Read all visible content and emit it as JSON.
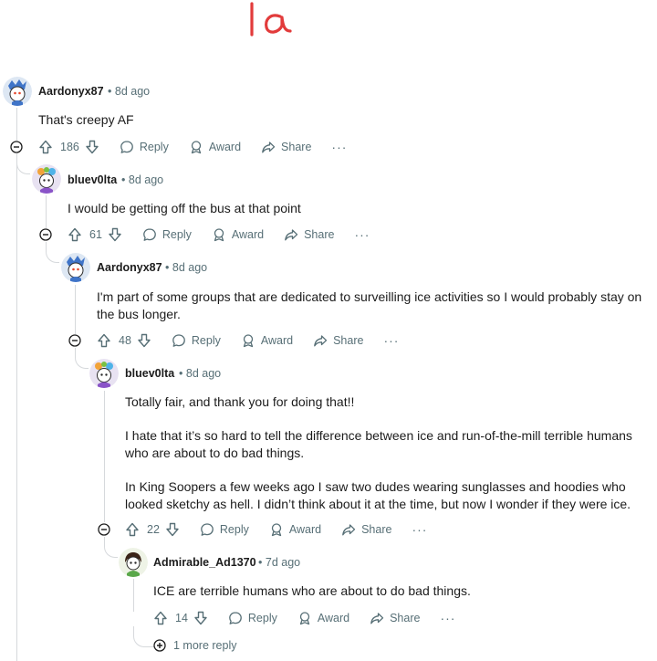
{
  "annotation": {
    "text": "1a",
    "color": "#e23b3b"
  },
  "comments": [
    {
      "username": "Aardonyx87",
      "separator": "•",
      "time": "8d ago",
      "paragraphs": [
        "That's creepy AF"
      ],
      "votes": "186",
      "reply": "Reply",
      "award": "Award",
      "share": "Share",
      "more": "···"
    },
    {
      "username": "bluev0lta",
      "separator": "•",
      "time": "8d ago",
      "paragraphs": [
        "I would be getting off the bus at that point"
      ],
      "votes": "61",
      "reply": "Reply",
      "award": "Award",
      "share": "Share",
      "more": "···"
    },
    {
      "username": "Aardonyx87",
      "separator": "•",
      "time": "8d ago",
      "paragraphs": [
        "I'm part of some groups that are dedicated to surveilling ice activities so I would probably stay on the bus longer."
      ],
      "votes": "48",
      "reply": "Reply",
      "award": "Award",
      "share": "Share",
      "more": "···"
    },
    {
      "username": "bluev0lta",
      "separator": "•",
      "time": "8d ago",
      "paragraphs": [
        "Totally fair, and thank you for doing that!!",
        "I hate that it’s so hard to tell the difference between ice and run-of-the-mill terrible humans who are about to do bad things.",
        "In King Soopers a few weeks ago I saw two dudes wearing sunglasses and hoodies who looked sketchy as hell. I didn’t think about it at the time, but now I wonder if they were ice."
      ],
      "votes": "22",
      "reply": "Reply",
      "award": "Award",
      "share": "Share",
      "more": "···"
    },
    {
      "username": "Admirable_Ad1370",
      "separator": "•",
      "time": "7d ago",
      "paragraphs": [
        "ICE are terrible humans who are about to do bad things."
      ],
      "votes": "14",
      "reply": "Reply",
      "award": "Award",
      "share": "Share",
      "more": "···"
    }
  ],
  "more_replies": "1 more reply",
  "icons": {
    "upvote": "upvote-arrow-icon",
    "downvote": "downvote-arrow-icon",
    "reply": "speech-bubble-icon",
    "award": "award-ribbon-icon",
    "share": "share-arrow-icon",
    "collapse": "minus-circle-icon",
    "expand": "plus-circle-icon"
  },
  "colors": {
    "meta": "#576f76",
    "thread": "#d6d9dc",
    "text": "#1c1c1c"
  }
}
